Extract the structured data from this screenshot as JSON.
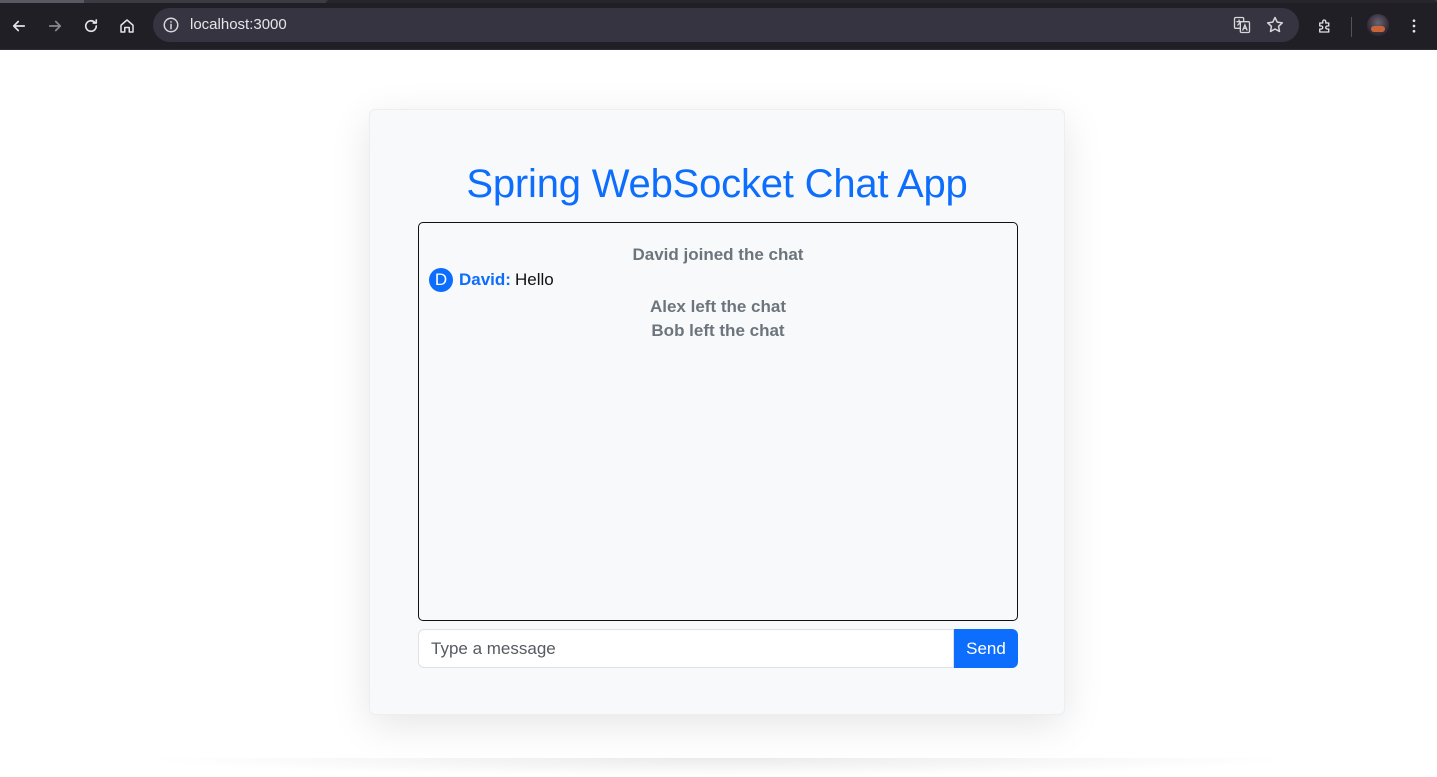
{
  "browser": {
    "url": "localhost:3000",
    "icons": {
      "back": "arrow-left-icon",
      "forward": "arrow-right-icon",
      "reload": "reload-icon",
      "home": "home-icon",
      "site_info": "info-icon",
      "translate": "translate-icon",
      "bookmark": "star-icon",
      "extensions": "puzzle-icon",
      "profile": "avatar",
      "menu": "kebab-menu-icon"
    }
  },
  "app": {
    "title": "Spring WebSocket Chat App",
    "accent_color": "#0d6efd",
    "messages": [
      {
        "type": "system",
        "text": "David joined the chat"
      },
      {
        "type": "chat",
        "avatar_letter": "D",
        "sender": "David:",
        "text": "Hello"
      },
      {
        "type": "system",
        "text": "Alex left the chat"
      },
      {
        "type": "system",
        "text": "Bob left the chat"
      }
    ],
    "input": {
      "placeholder": "Type a message",
      "value": ""
    },
    "send_label": "Send"
  }
}
